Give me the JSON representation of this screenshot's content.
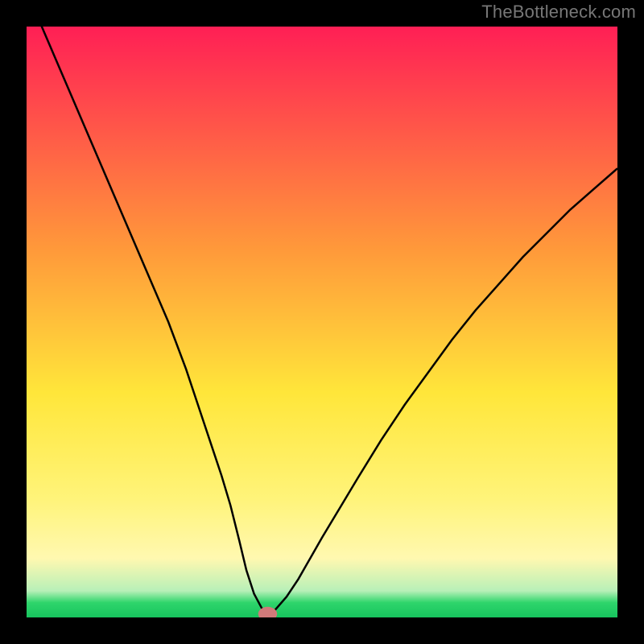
{
  "watermark": "TheBottleneck.com",
  "colors": {
    "top": "#ff1f55",
    "mid_top": "#ffb13a",
    "mid": "#ffe63a",
    "mid_low": "#fff8b0",
    "green": "#2ed56b",
    "marker": "#d17a7a",
    "curve": "#000000",
    "frame": "#000000"
  },
  "chart_data": {
    "type": "line",
    "title": "",
    "xlabel": "",
    "ylabel": "",
    "xlim": [
      0,
      100
    ],
    "ylim": [
      0,
      100
    ],
    "series": [
      {
        "name": "bottleneck-curve",
        "x": [
          0,
          3,
          6,
          9,
          12,
          15,
          18,
          21,
          24,
          27,
          29,
          31,
          33,
          34.5,
          36,
          37.2,
          38.5,
          40,
          41,
          42,
          44,
          46,
          48,
          50,
          53,
          56,
          60,
          64,
          68,
          72,
          76,
          80,
          84,
          88,
          92,
          96,
          100
        ],
        "y": [
          106,
          99,
          92,
          85,
          78,
          71,
          64,
          57,
          50,
          42,
          36,
          30,
          24,
          19,
          13,
          8,
          4,
          1.2,
          0.5,
          1.2,
          3.5,
          6.5,
          10,
          13.5,
          18.5,
          23.5,
          30,
          36,
          41.5,
          47,
          52,
          56.5,
          61,
          65,
          69,
          72.5,
          76
        ]
      }
    ],
    "marker": {
      "x": 40.8,
      "y": 0.6,
      "rx": 1.6,
      "ry": 1.2
    },
    "gradient_stops": [
      {
        "offset": 0,
        "value": 100
      },
      {
        "offset": 0.38,
        "value": 62
      },
      {
        "offset": 0.62,
        "value": 38
      },
      {
        "offset": 0.8,
        "value": 20
      },
      {
        "offset": 0.9,
        "value": 10
      },
      {
        "offset": 0.955,
        "value": 4.5
      },
      {
        "offset": 0.975,
        "value": 2.5
      },
      {
        "offset": 1.0,
        "value": 0
      }
    ]
  }
}
